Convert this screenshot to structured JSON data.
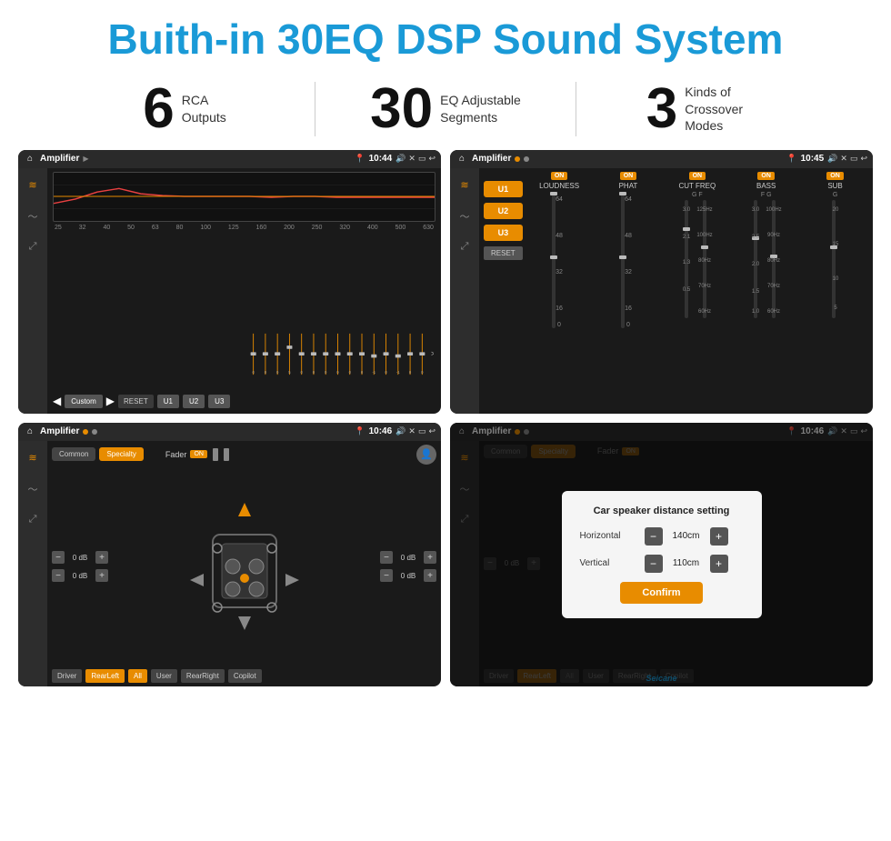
{
  "header": {
    "title": "Buith-in 30EQ DSP Sound System"
  },
  "stats": [
    {
      "number": "6",
      "label": "RCA\nOutputs"
    },
    {
      "number": "30",
      "label": "EQ Adjustable\nSegments"
    },
    {
      "number": "3",
      "label": "Kinds of\nCrossover Modes"
    }
  ],
  "screens": [
    {
      "id": "screen-eq",
      "topbar": {
        "title": "Amplifier",
        "time": "10:44"
      },
      "eq_labels": [
        "25",
        "32",
        "40",
        "50",
        "63",
        "80",
        "100",
        "125",
        "160",
        "200",
        "250",
        "320",
        "400",
        "500",
        "630"
      ],
      "eq_values": [
        "0",
        "0",
        "0",
        "5",
        "0",
        "0",
        "0",
        "0",
        "0",
        "0",
        "-1",
        "0",
        "-1"
      ],
      "bottom_buttons": [
        "Custom",
        "RESET",
        "U1",
        "U2",
        "U3"
      ]
    },
    {
      "id": "screen-amp2",
      "topbar": {
        "title": "Amplifier",
        "time": "10:45"
      },
      "channels": [
        "LOUDNESS",
        "PHAT",
        "CUT FREQ",
        "BASS",
        "SUB"
      ],
      "u_buttons": [
        "U1",
        "U2",
        "U3"
      ],
      "reset_label": "RESET"
    },
    {
      "id": "screen-fader",
      "topbar": {
        "title": "Amplifier",
        "time": "10:46"
      },
      "tabs": [
        "Common",
        "Specialty"
      ],
      "fader_label": "Fader",
      "on_label": "ON",
      "channels_left": [
        "0 dB",
        "0 dB"
      ],
      "channels_right": [
        "0 dB",
        "0 dB"
      ],
      "bottom_buttons": [
        "Driver",
        "RearLeft",
        "All",
        "User",
        "RearRight",
        "Copilot"
      ]
    },
    {
      "id": "screen-dialog",
      "topbar": {
        "title": "Amplifier",
        "time": "10:46"
      },
      "dialog": {
        "title": "Car speaker distance setting",
        "horizontal_label": "Horizontal",
        "horizontal_value": "140cm",
        "vertical_label": "Vertical",
        "vertical_value": "110cm",
        "confirm_label": "Confirm"
      },
      "tabs": [
        "Common",
        "Specialty"
      ],
      "on_label": "ON",
      "channels_right": [
        "0 dB",
        "0 dB"
      ],
      "bottom_buttons": [
        "Driver",
        "RearLeft",
        "All",
        "User",
        "RearRight",
        "Copilot"
      ]
    }
  ],
  "watermark": "Seicane"
}
